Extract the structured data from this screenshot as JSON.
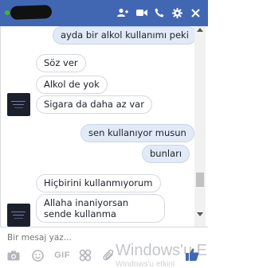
{
  "titlebar": {
    "color": "#4267b2",
    "icons": [
      "add-contact-icon",
      "video-call-icon",
      "phone-icon",
      "gear-icon",
      "close-icon"
    ]
  },
  "messages": [
    {
      "side": "out",
      "text": "ayda bir alkol kullanımı peki"
    },
    {
      "side": "in",
      "text": "Söz ver"
    },
    {
      "side": "in",
      "text": "Alkol de yok"
    },
    {
      "side": "in",
      "text": "Sigara da daha az var"
    },
    {
      "side": "out",
      "text": "sen kullanıyor musun"
    },
    {
      "side": "out",
      "text": "bunları"
    },
    {
      "side": "in",
      "text": "Hiçbirini kullanmıyorum"
    },
    {
      "side": "in",
      "text": "Allaha inaniyorsan sende kullanma"
    }
  ],
  "composer": {
    "placeholder": "Bir mesaj yaz...",
    "gif_label": "GIF",
    "icons": [
      "camera-icon",
      "emoji-icon",
      "gif-icon",
      "sticker-icon",
      "attachment-icon",
      "thumbs-up-icon"
    ]
  },
  "watermark": {
    "text": "Windows'u E",
    "subtext": "Windows'u etkinl"
  },
  "colors": {
    "outgoing_bubble": "#e1eaf6",
    "incoming_bubble": "#ffffff",
    "accent": "#4267b2"
  }
}
